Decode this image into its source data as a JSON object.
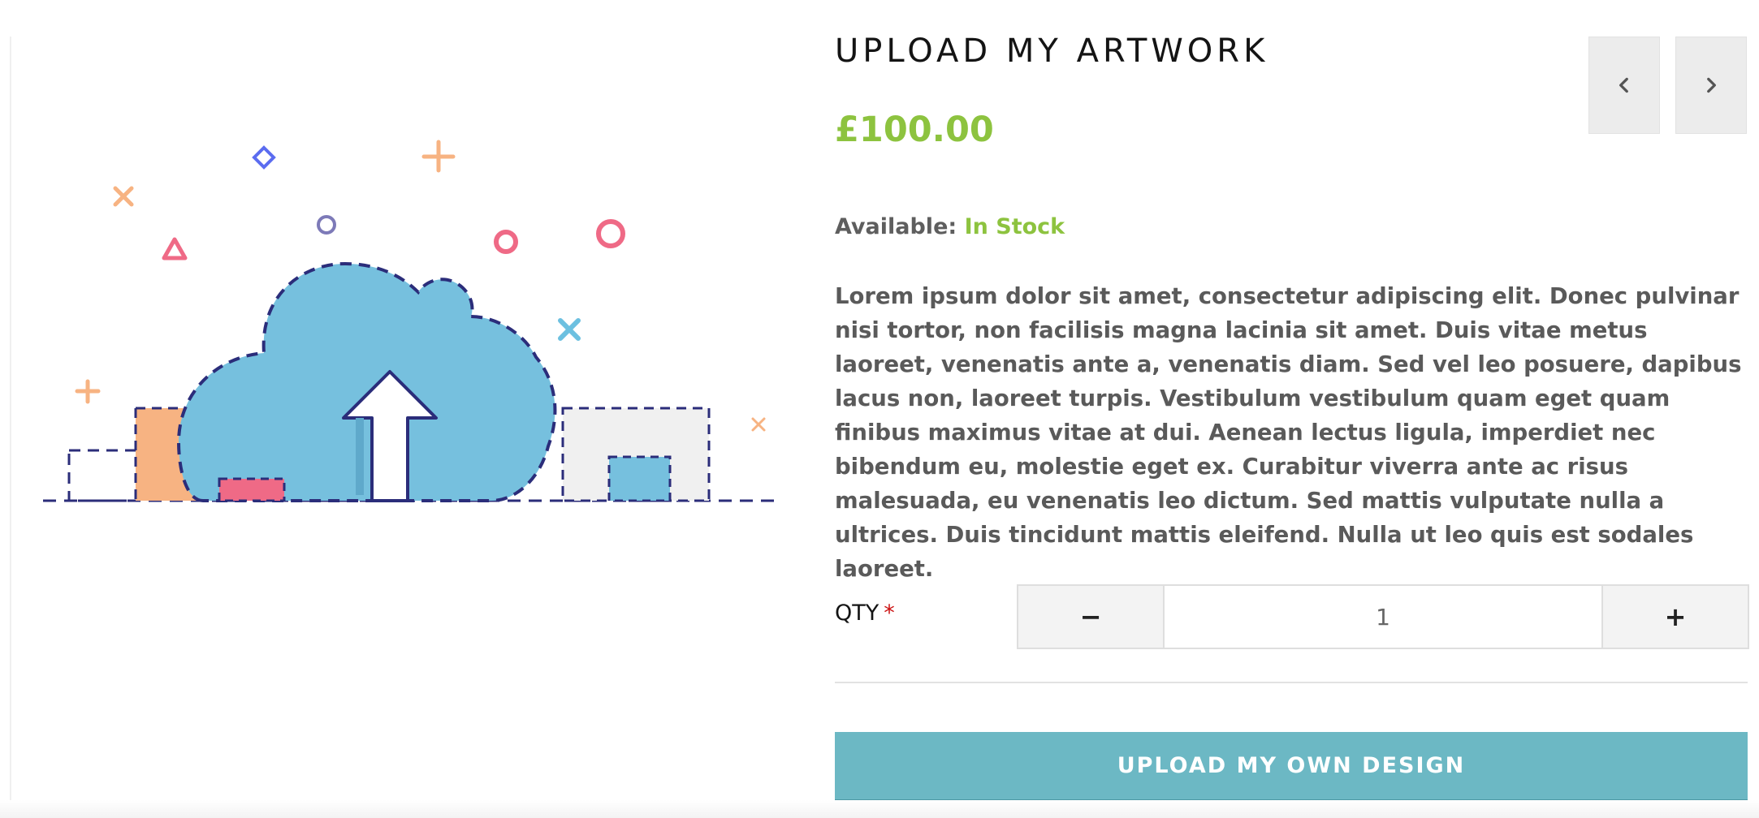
{
  "product": {
    "title": "UPLOAD MY ARTWORK",
    "price": "£100.00",
    "availability_label": "Available:",
    "availability_value": "In Stock",
    "description": "Lorem ipsum dolor sit amet, consectetur adipiscing elit. Donec pulvinar nisi tortor, non facilisis magna lacinia sit amet. Duis vitae metus laoreet, venenatis ante a, venenatis diam. Sed vel leo posuere, dapibus lacus non, laoreet turpis. Vestibulum vestibulum quam eget quam finibus maximus vitae at dui. Aenean lectus ligula, imperdiet nec bibendum eu, molestie eget ex. Curabitur viverra ante ac risus malesuada, eu venenatis leo dictum. Sed mattis vulputate nulla a ultrices. Duis tincidunt mattis eleifend. Nulla ut leo quis est sodales laoreet."
  },
  "nav": {
    "prev_icon": "chevron-left-icon",
    "next_icon": "chevron-right-icon"
  },
  "quantity": {
    "label": "QTY",
    "required_marker": "*",
    "value": "1",
    "minus_label": "−",
    "plus_label": "+"
  },
  "actions": {
    "upload_label": "UPLOAD MY OWN DESIGN"
  },
  "illustration": {
    "icon": "cloud-upload-icon"
  },
  "colors": {
    "accent_green": "#8dc33f",
    "button_teal": "#6cb8c4",
    "cloud_blue": "#76c0de",
    "outline_navy": "#2b2d7a",
    "peach": "#f7b382",
    "pink": "#ef6a86"
  }
}
